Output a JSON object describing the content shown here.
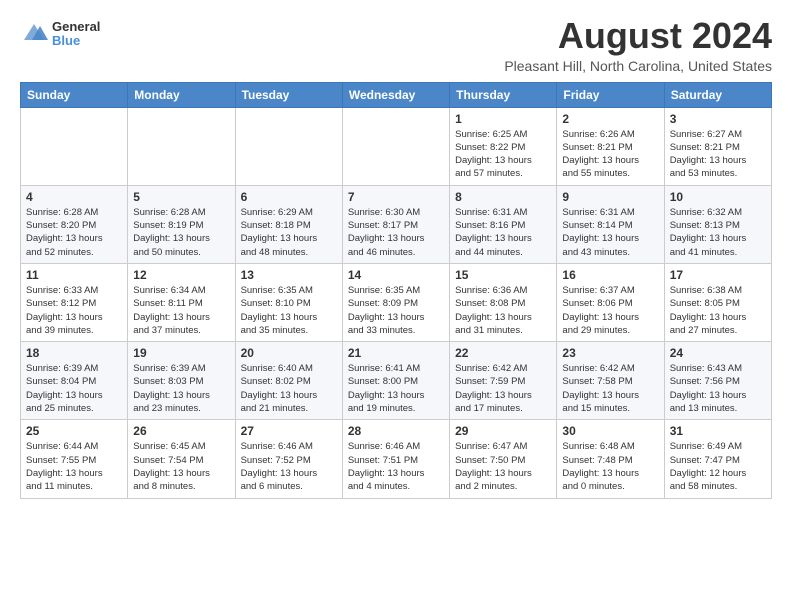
{
  "header": {
    "logo_general": "General",
    "logo_blue": "Blue",
    "month_year": "August 2024",
    "location": "Pleasant Hill, North Carolina, United States"
  },
  "days_of_week": [
    "Sunday",
    "Monday",
    "Tuesday",
    "Wednesday",
    "Thursday",
    "Friday",
    "Saturday"
  ],
  "weeks": [
    [
      {
        "day": "",
        "info": ""
      },
      {
        "day": "",
        "info": ""
      },
      {
        "day": "",
        "info": ""
      },
      {
        "day": "",
        "info": ""
      },
      {
        "day": "1",
        "info": "Sunrise: 6:25 AM\nSunset: 8:22 PM\nDaylight: 13 hours\nand 57 minutes."
      },
      {
        "day": "2",
        "info": "Sunrise: 6:26 AM\nSunset: 8:21 PM\nDaylight: 13 hours\nand 55 minutes."
      },
      {
        "day": "3",
        "info": "Sunrise: 6:27 AM\nSunset: 8:21 PM\nDaylight: 13 hours\nand 53 minutes."
      }
    ],
    [
      {
        "day": "4",
        "info": "Sunrise: 6:28 AM\nSunset: 8:20 PM\nDaylight: 13 hours\nand 52 minutes."
      },
      {
        "day": "5",
        "info": "Sunrise: 6:28 AM\nSunset: 8:19 PM\nDaylight: 13 hours\nand 50 minutes."
      },
      {
        "day": "6",
        "info": "Sunrise: 6:29 AM\nSunset: 8:18 PM\nDaylight: 13 hours\nand 48 minutes."
      },
      {
        "day": "7",
        "info": "Sunrise: 6:30 AM\nSunset: 8:17 PM\nDaylight: 13 hours\nand 46 minutes."
      },
      {
        "day": "8",
        "info": "Sunrise: 6:31 AM\nSunset: 8:16 PM\nDaylight: 13 hours\nand 44 minutes."
      },
      {
        "day": "9",
        "info": "Sunrise: 6:31 AM\nSunset: 8:14 PM\nDaylight: 13 hours\nand 43 minutes."
      },
      {
        "day": "10",
        "info": "Sunrise: 6:32 AM\nSunset: 8:13 PM\nDaylight: 13 hours\nand 41 minutes."
      }
    ],
    [
      {
        "day": "11",
        "info": "Sunrise: 6:33 AM\nSunset: 8:12 PM\nDaylight: 13 hours\nand 39 minutes."
      },
      {
        "day": "12",
        "info": "Sunrise: 6:34 AM\nSunset: 8:11 PM\nDaylight: 13 hours\nand 37 minutes."
      },
      {
        "day": "13",
        "info": "Sunrise: 6:35 AM\nSunset: 8:10 PM\nDaylight: 13 hours\nand 35 minutes."
      },
      {
        "day": "14",
        "info": "Sunrise: 6:35 AM\nSunset: 8:09 PM\nDaylight: 13 hours\nand 33 minutes."
      },
      {
        "day": "15",
        "info": "Sunrise: 6:36 AM\nSunset: 8:08 PM\nDaylight: 13 hours\nand 31 minutes."
      },
      {
        "day": "16",
        "info": "Sunrise: 6:37 AM\nSunset: 8:06 PM\nDaylight: 13 hours\nand 29 minutes."
      },
      {
        "day": "17",
        "info": "Sunrise: 6:38 AM\nSunset: 8:05 PM\nDaylight: 13 hours\nand 27 minutes."
      }
    ],
    [
      {
        "day": "18",
        "info": "Sunrise: 6:39 AM\nSunset: 8:04 PM\nDaylight: 13 hours\nand 25 minutes."
      },
      {
        "day": "19",
        "info": "Sunrise: 6:39 AM\nSunset: 8:03 PM\nDaylight: 13 hours\nand 23 minutes."
      },
      {
        "day": "20",
        "info": "Sunrise: 6:40 AM\nSunset: 8:02 PM\nDaylight: 13 hours\nand 21 minutes."
      },
      {
        "day": "21",
        "info": "Sunrise: 6:41 AM\nSunset: 8:00 PM\nDaylight: 13 hours\nand 19 minutes."
      },
      {
        "day": "22",
        "info": "Sunrise: 6:42 AM\nSunset: 7:59 PM\nDaylight: 13 hours\nand 17 minutes."
      },
      {
        "day": "23",
        "info": "Sunrise: 6:42 AM\nSunset: 7:58 PM\nDaylight: 13 hours\nand 15 minutes."
      },
      {
        "day": "24",
        "info": "Sunrise: 6:43 AM\nSunset: 7:56 PM\nDaylight: 13 hours\nand 13 minutes."
      }
    ],
    [
      {
        "day": "25",
        "info": "Sunrise: 6:44 AM\nSunset: 7:55 PM\nDaylight: 13 hours\nand 11 minutes."
      },
      {
        "day": "26",
        "info": "Sunrise: 6:45 AM\nSunset: 7:54 PM\nDaylight: 13 hours\nand 8 minutes."
      },
      {
        "day": "27",
        "info": "Sunrise: 6:46 AM\nSunset: 7:52 PM\nDaylight: 13 hours\nand 6 minutes."
      },
      {
        "day": "28",
        "info": "Sunrise: 6:46 AM\nSunset: 7:51 PM\nDaylight: 13 hours\nand 4 minutes."
      },
      {
        "day": "29",
        "info": "Sunrise: 6:47 AM\nSunset: 7:50 PM\nDaylight: 13 hours\nand 2 minutes."
      },
      {
        "day": "30",
        "info": "Sunrise: 6:48 AM\nSunset: 7:48 PM\nDaylight: 13 hours\nand 0 minutes."
      },
      {
        "day": "31",
        "info": "Sunrise: 6:49 AM\nSunset: 7:47 PM\nDaylight: 12 hours\nand 58 minutes."
      }
    ]
  ]
}
